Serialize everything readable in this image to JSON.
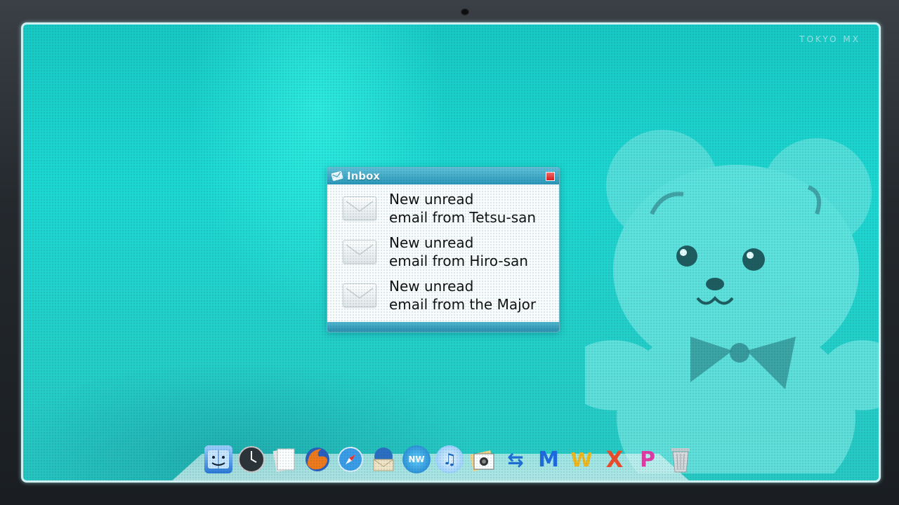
{
  "watermark": "TOKYO MX",
  "inbox": {
    "title": "Inbox",
    "icon": "mail-icon",
    "close_icon": "close-icon",
    "messages": [
      {
        "line1": "New unread",
        "line2": "email from Tetsu-san",
        "icon": "envelope-icon"
      },
      {
        "line1": "New unread",
        "line2": "email from Hiro-san",
        "icon": "envelope-icon"
      },
      {
        "line1": "New unread",
        "line2": "email from the Major",
        "icon": "envelope-icon"
      }
    ]
  },
  "dock": {
    "items": [
      {
        "name": "finder-icon"
      },
      {
        "name": "clock-icon"
      },
      {
        "name": "documents-icon"
      },
      {
        "name": "firefox-icon"
      },
      {
        "name": "safari-icon"
      },
      {
        "name": "mail-app-icon"
      },
      {
        "name": "nw-app-icon",
        "glyph": "NW"
      },
      {
        "name": "itunes-icon",
        "glyph": "♫"
      },
      {
        "name": "photos-icon"
      },
      {
        "name": "blue-app-icon",
        "glyph": "⇆"
      },
      {
        "name": "m-app-icon",
        "glyph": "M"
      },
      {
        "name": "w-app-icon",
        "glyph": "W"
      },
      {
        "name": "x-app-icon",
        "glyph": "X"
      },
      {
        "name": "p-app-icon",
        "glyph": "P"
      },
      {
        "name": "trash-icon"
      }
    ]
  },
  "colors": {
    "desktop": "#1dd8d2",
    "titlebar": "#2a97b8",
    "close": "#d91d1d"
  }
}
